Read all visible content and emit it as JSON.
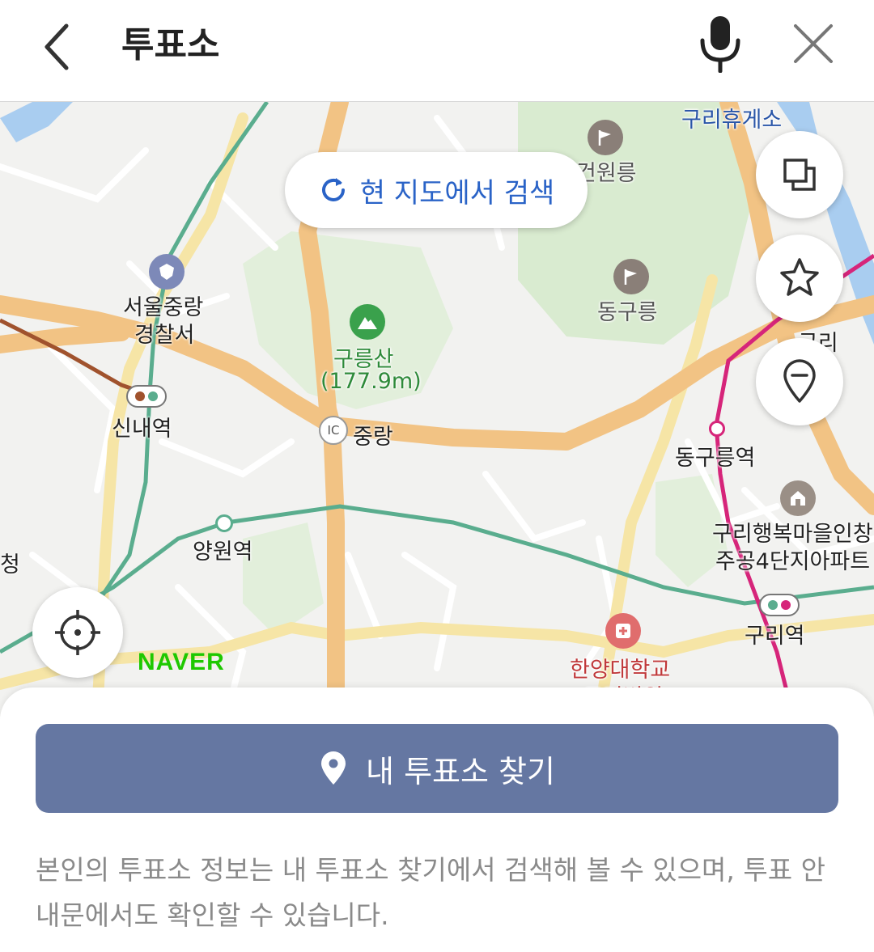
{
  "search": {
    "query": "투표소",
    "icons": {
      "back": "back-chevron-icon",
      "mic": "microphone-icon",
      "clear": "close-icon"
    }
  },
  "map": {
    "research_label": "현 지도에서 검색",
    "labels": {
      "guri_rest_area": "구리휴게소",
      "geonwonneung": "건원릉",
      "donggureung": "동구릉",
      "police_line1": "서울중랑",
      "police_line2": "경찰서",
      "mountain_name": "구릉산",
      "mountain_height": "(177.9m)",
      "ic_jungnang": "중랑",
      "ic_badge": "IC",
      "sinnae": "신내역",
      "yangwon": "양원역",
      "donggureung_station": "동구릉역",
      "guri_station": "구리역",
      "guri_ic": "구리",
      "apt_line1": "구리행복마을인창",
      "apt_line2": "주공4단지아파트",
      "hospital_line1": "한양대학교",
      "hospital_line2": "구리병원",
      "edge_char": "청"
    },
    "logo": "NAVER",
    "controls": {
      "layers": "layers-icon",
      "favorite": "star-icon",
      "location_pin": "location-pin-icon",
      "my_location": "crosshair-icon"
    },
    "colors": {
      "road_major": "#f2c384",
      "road_minor": "#f6e5a6",
      "green_area": "#d9ebd0",
      "subway_green": "#5aad8e",
      "subway_pink": "#d6257a",
      "subway_brown": "#a0522d"
    }
  },
  "sheet": {
    "find_button_label": "내 투표소 찾기",
    "info_text": "본인의 투표소 정보는 내 투표소 찾기에서 검색해 볼 수 있으며, 투표 안내문에서도 확인할 수 있습니다.",
    "accent_color": "#6577a2"
  }
}
